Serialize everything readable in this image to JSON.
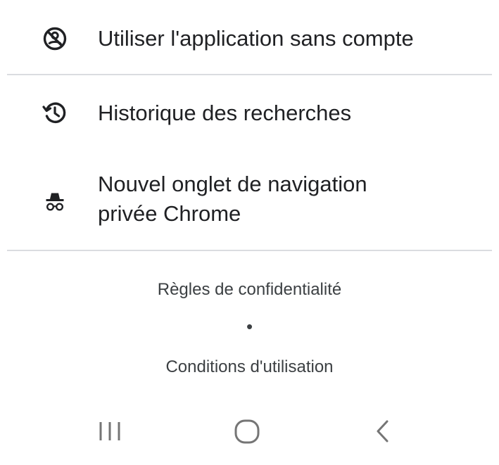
{
  "menu": {
    "items": [
      {
        "icon": "no-account-icon",
        "label": "Utiliser l'application sans compte"
      },
      {
        "icon": "history-icon",
        "label": "Historique des recherches"
      },
      {
        "icon": "incognito-icon",
        "label_line1": "Nouvel onglet de navigation",
        "label_line2": "privée Chrome"
      }
    ]
  },
  "footer": {
    "privacy_label": "Règles de confidentialité",
    "separator": "•",
    "terms_label": "Conditions d'utilisation"
  },
  "navbar": {
    "buttons": [
      {
        "icon": "recent-apps-icon"
      },
      {
        "icon": "home-icon"
      },
      {
        "icon": "back-icon"
      }
    ]
  },
  "colors": {
    "text": "#202124",
    "secondary_text": "#3c4043",
    "divider": "#dadce0",
    "nav_icon": "#757575"
  }
}
